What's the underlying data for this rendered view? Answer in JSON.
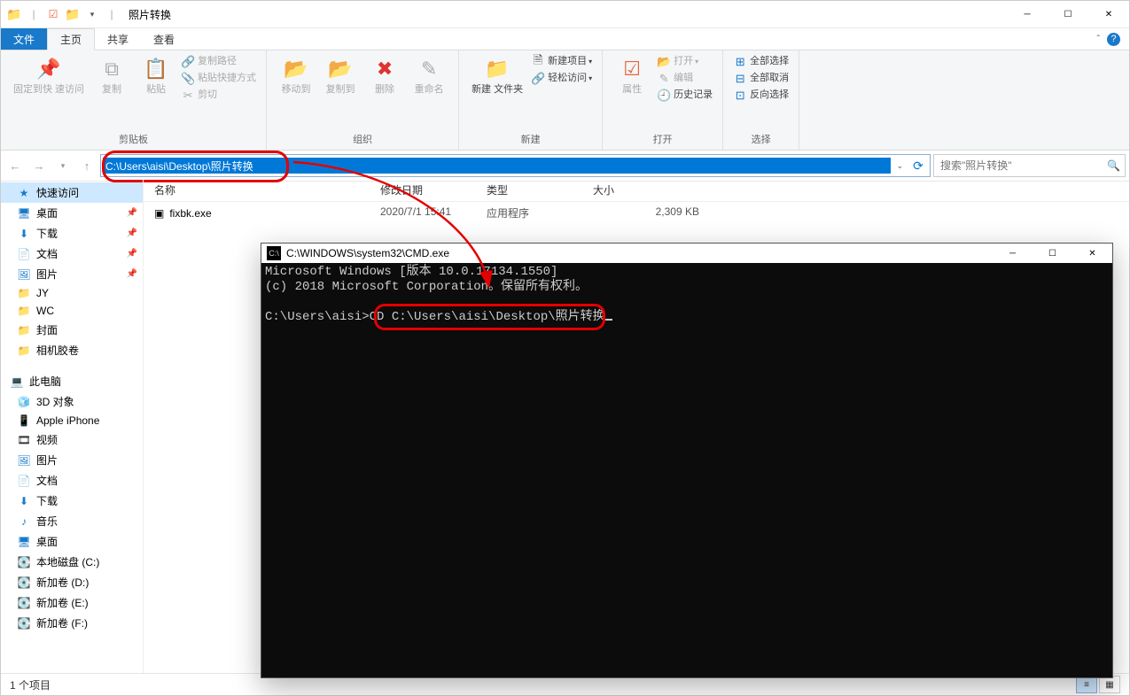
{
  "window": {
    "title": "照片转换",
    "tabs": {
      "file": "文件",
      "home": "主页",
      "share": "共享",
      "view": "查看"
    }
  },
  "ribbon": {
    "clipboard": {
      "pin": "固定到快\n速访问",
      "copy": "复制",
      "paste": "粘贴",
      "copypath": "复制路径",
      "pasteshortcut": "粘贴快捷方式",
      "cut": "剪切",
      "label": "剪贴板"
    },
    "organize": {
      "moveto": "移动到",
      "copyto": "复制到",
      "delete": "删除",
      "rename": "重命名",
      "label": "组织"
    },
    "new": {
      "newfolder": "新建\n文件夹",
      "newitem": "新建项目",
      "easyaccess": "轻松访问",
      "label": "新建"
    },
    "open": {
      "properties": "属性",
      "open": "打开",
      "edit": "编辑",
      "history": "历史记录",
      "label": "打开"
    },
    "select": {
      "selectall": "全部选择",
      "selectnone": "全部取消",
      "invert": "反向选择",
      "label": "选择"
    }
  },
  "nav": {
    "path": "C:\\Users\\aisi\\Desktop\\照片转换",
    "searchPlaceholder": "搜索\"照片转换\""
  },
  "columns": {
    "name": "名称",
    "date": "修改日期",
    "type": "类型",
    "size": "大小"
  },
  "files": [
    {
      "name": "fixbk.exe",
      "date": "2020/7/1 15:41",
      "type": "应用程序",
      "size": "2,309 KB"
    }
  ],
  "sidebar": {
    "quick": "快速访问",
    "desktop": "桌面",
    "downloads": "下载",
    "documents": "文档",
    "pictures": "图片",
    "f1": "JY",
    "f2": "WC",
    "f3": "封面",
    "f4": "相机胶卷",
    "thispc": "此电脑",
    "objects3d": "3D 对象",
    "iphone": "Apple iPhone",
    "videos": "视频",
    "pictures2": "图片",
    "documents2": "文档",
    "downloads2": "下载",
    "music": "音乐",
    "desktop2": "桌面",
    "diskc": "本地磁盘 (C:)",
    "diskd": "新加卷 (D:)",
    "diske": "新加卷 (E:)",
    "diskf": "新加卷 (F:)"
  },
  "status": {
    "count": "1 个项目"
  },
  "cmd": {
    "title": "C:\\WINDOWS\\system32\\CMD.exe",
    "line1": "Microsoft Windows [版本 10.0.17134.1550]",
    "line2": "(c) 2018 Microsoft Corporation。保留所有权利。",
    "prompt": "C:\\Users\\aisi>",
    "cmd": "CD C:\\Users\\aisi\\Desktop\\照片转换"
  }
}
